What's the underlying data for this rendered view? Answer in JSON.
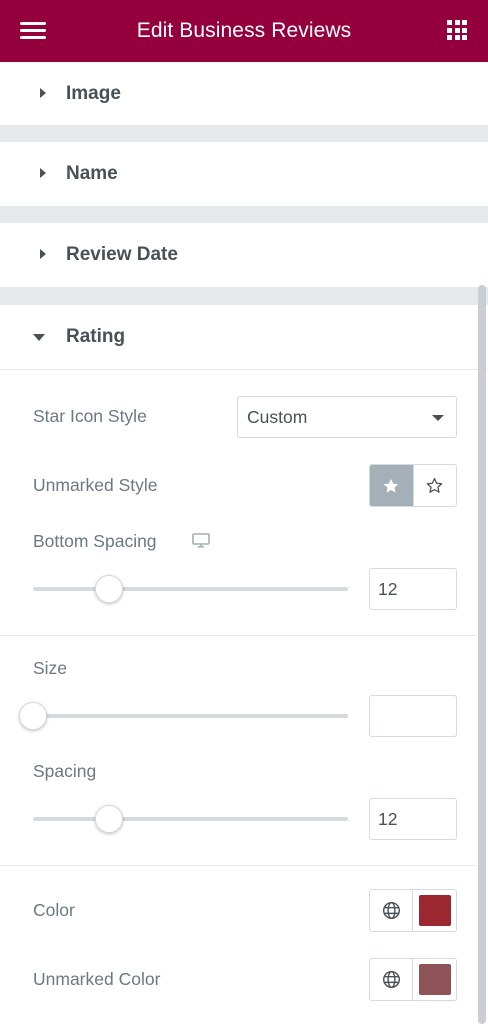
{
  "header": {
    "title": "Edit Business Reviews",
    "menu_icon": "hamburger-icon",
    "apps_icon": "grid-icon",
    "bg_color": "#93003c"
  },
  "sections": {
    "image": {
      "label": "Image",
      "expanded": false
    },
    "name": {
      "label": "Name",
      "expanded": false
    },
    "review_date": {
      "label": "Review Date",
      "expanded": false
    },
    "rating": {
      "label": "Rating",
      "expanded": true
    }
  },
  "rating": {
    "star_icon_style": {
      "label": "Star Icon Style",
      "value": "Custom"
    },
    "unmarked_style": {
      "label": "Unmarked Style",
      "options": [
        "solid-star-icon",
        "outline-star-icon"
      ],
      "selected": 0
    },
    "bottom_spacing": {
      "label": "Bottom Spacing",
      "device_icon": "desktop-icon",
      "value": "12",
      "slider_fraction": 0.24
    },
    "size": {
      "label": "Size",
      "value": "",
      "slider_fraction": 0.0
    },
    "spacing": {
      "label": "Spacing",
      "value": "12",
      "slider_fraction": 0.24
    },
    "color": {
      "label": "Color",
      "globe_icon": "globe-icon",
      "swatch": "#9b2830"
    },
    "unmarked_color": {
      "label": "Unmarked Color",
      "globe_icon": "globe-icon",
      "swatch": "#8e5356"
    }
  }
}
